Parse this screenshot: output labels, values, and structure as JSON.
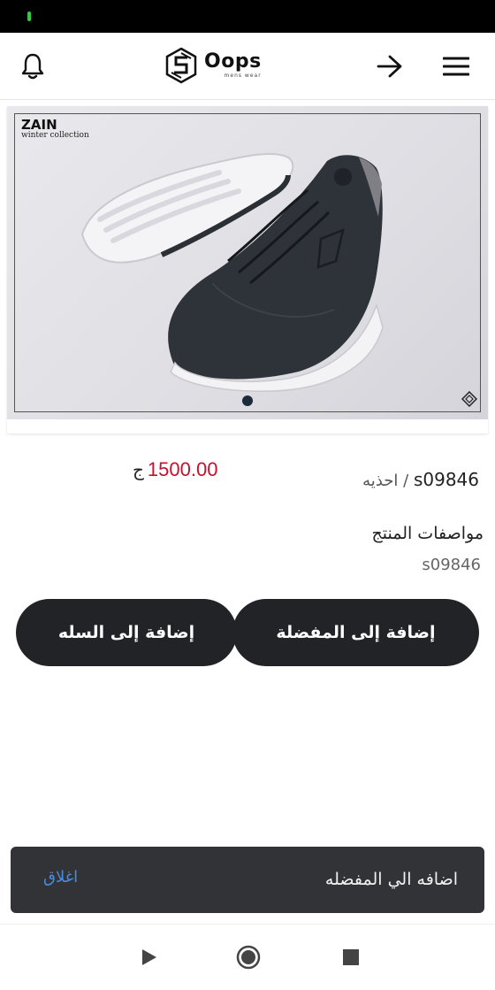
{
  "header": {
    "logo_name": "Oops",
    "logo_tagline": "mens wear"
  },
  "product": {
    "image_brand": "ZAIN",
    "image_caption": "winter collection",
    "price": "1500.00",
    "currency": "ج",
    "sku": "s09846",
    "category": "احذيه",
    "sku_separator": "/",
    "specs_title": "مواصفات المنتج",
    "specs_value": "s09846",
    "carousel_count": 1,
    "carousel_index": 0
  },
  "actions": {
    "add_to_favorites": "إضافة إلى المفضلة",
    "add_to_cart": "إضافة إلى السله"
  },
  "snackbar": {
    "message": "اضافه الي المفضله",
    "close_label": "اغلاق"
  },
  "icons": {
    "notification": "bell-icon",
    "back": "arrow-right-icon",
    "menu": "hamburger-menu-icon",
    "nav_back": "triangle-back-icon",
    "nav_home": "circle-home-icon",
    "nav_recent": "square-recent-icon"
  },
  "colors": {
    "price": "#c8102e",
    "button_bg": "#222327",
    "snackbar_bg": "#323337",
    "snackbar_action": "#4a8cdd"
  }
}
